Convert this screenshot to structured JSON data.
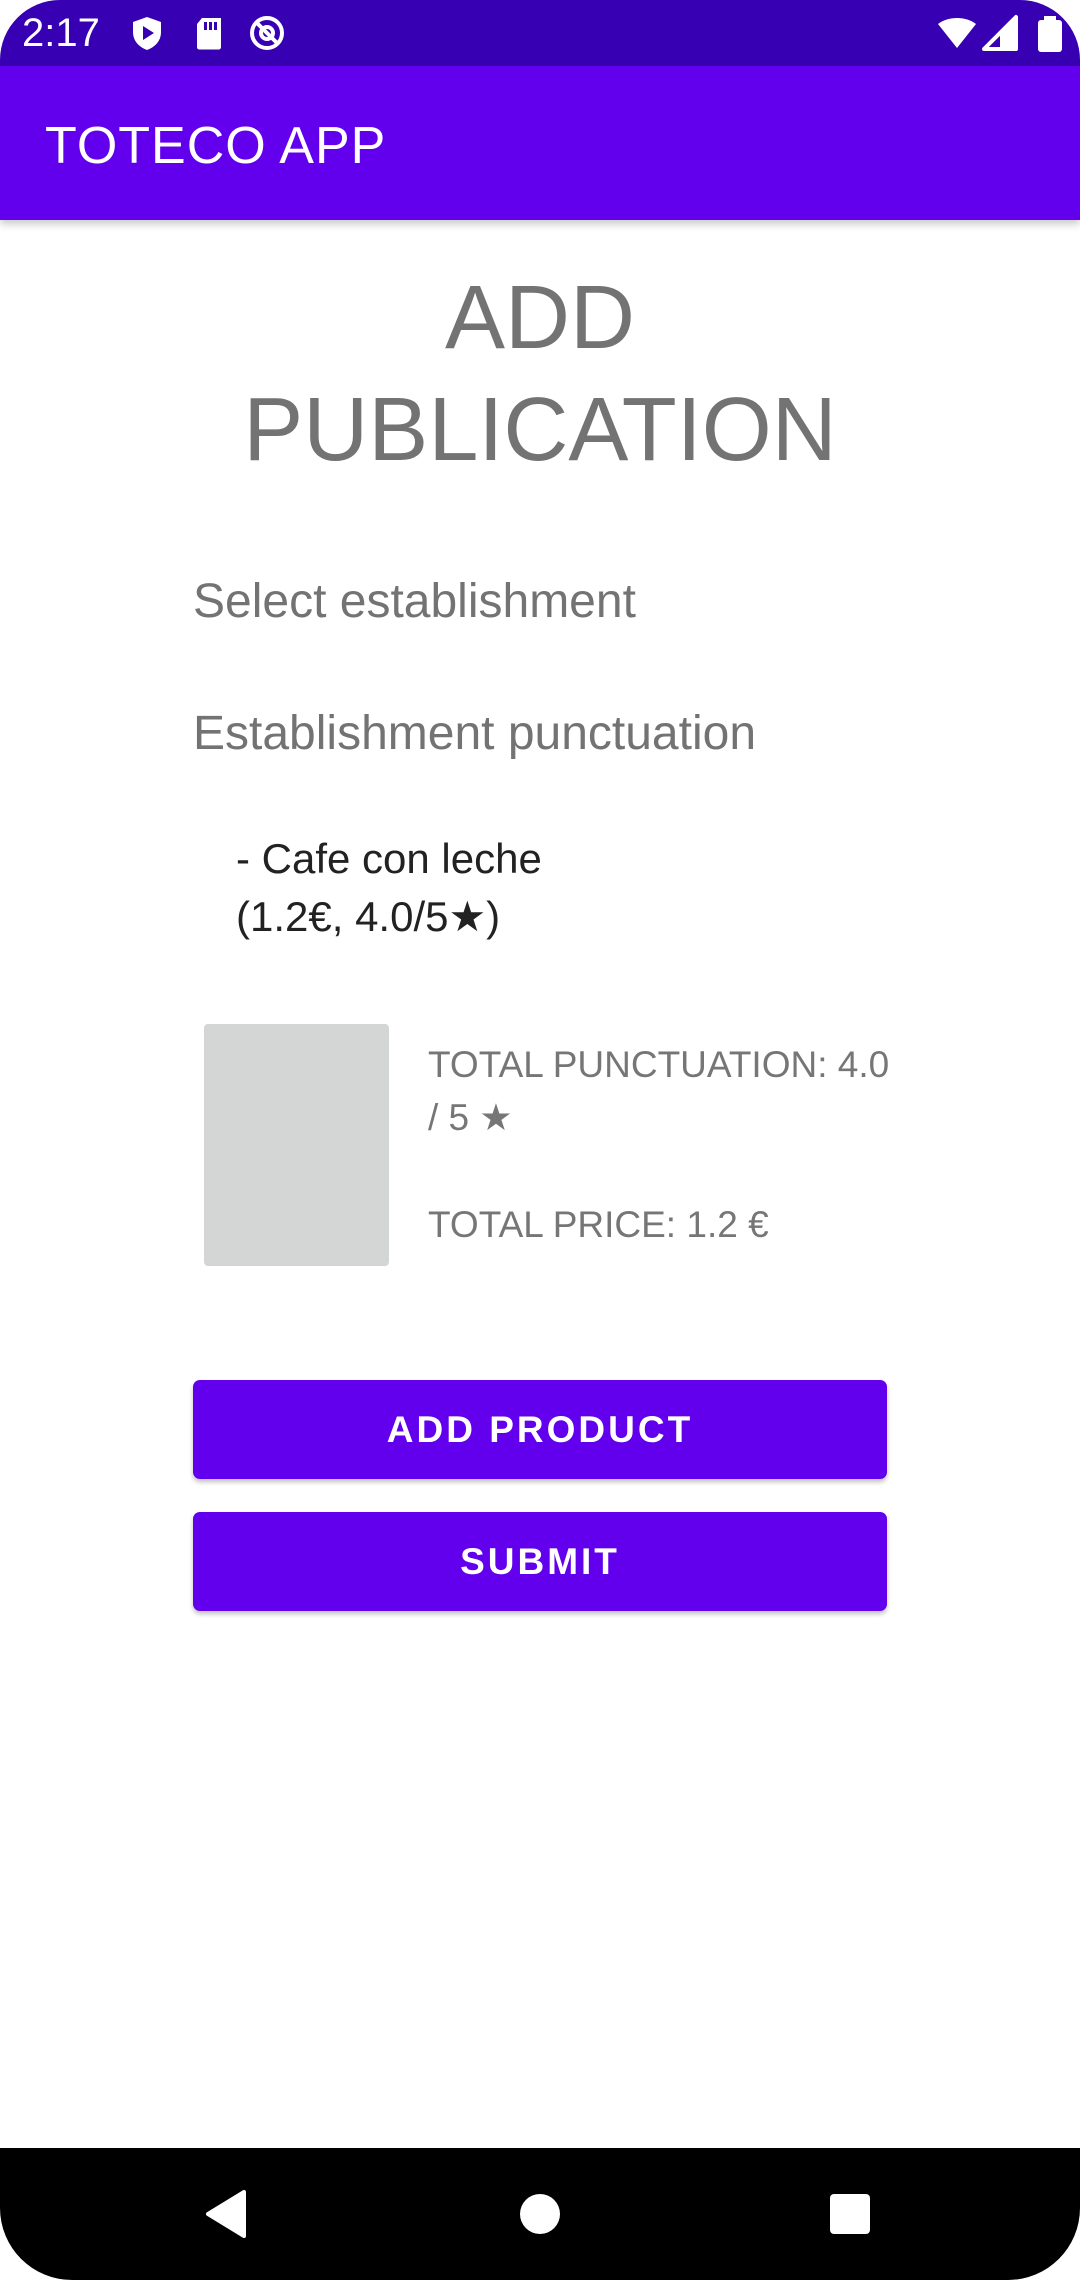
{
  "status_bar": {
    "time": "2:17",
    "icons": [
      "play-protect-icon",
      "sd-card-icon",
      "at-sign-icon",
      "wifi-icon",
      "signal-icon",
      "battery-icon"
    ]
  },
  "app_bar": {
    "title": "TOTECO APP",
    "color": "#6200ee"
  },
  "main": {
    "title": "ADD PUBLICATION",
    "select_establishment": "Select establishment",
    "establishment_punctuation": "Establishment punctuation",
    "products": [
      {
        "text": "- Cafe con leche\n(1.2€, 4.0/5★)"
      }
    ],
    "summary": {
      "total_punctuation": "TOTAL PUNCTUATION: 4.0 / 5 ★",
      "total_price": "TOTAL PRICE: 1.2 €"
    },
    "buttons": {
      "add_product": "ADD PRODUCT",
      "submit": "SUBMIT"
    }
  },
  "nav_bar": {
    "buttons": [
      "back-icon",
      "home-icon",
      "recents-icon"
    ]
  },
  "colors": {
    "primary": "#6200ee",
    "primary_dark": "#3700b3",
    "placeholder": "#d4d6d6"
  }
}
